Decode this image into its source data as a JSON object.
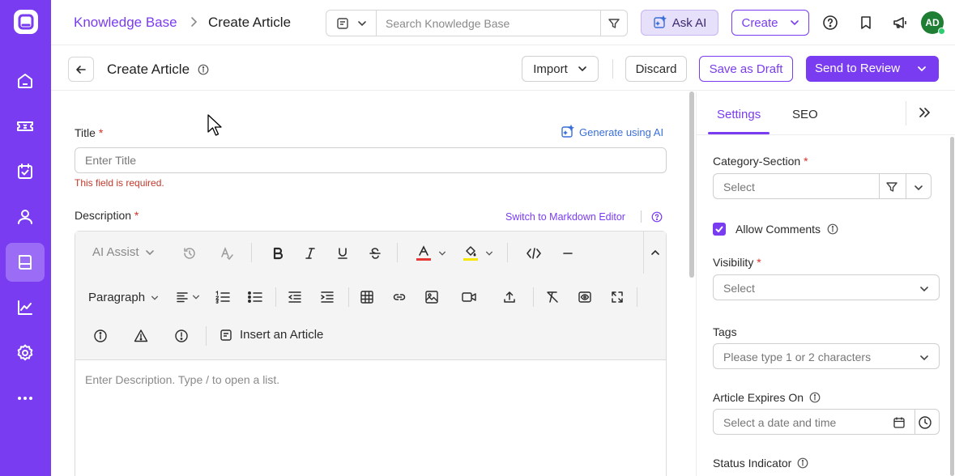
{
  "breadcrumb": {
    "root": "Knowledge Base",
    "current": "Create Article"
  },
  "search": {
    "placeholder": "Search Knowledge Base"
  },
  "header": {
    "ask_ai": "Ask AI",
    "create": "Create",
    "avatar_initials": "AD"
  },
  "subheader": {
    "title": "Create Article",
    "import": "Import",
    "discard": "Discard",
    "save_draft": "Save as Draft",
    "send_review": "Send to Review"
  },
  "form": {
    "title_label": "Title",
    "required_mark": "*",
    "generate_ai": "Generate using AI",
    "title_placeholder": "Enter Title",
    "title_error": "This field is required.",
    "description_label": "Description",
    "markdown_switch": "Switch to Markdown Editor",
    "description_placeholder": "Enter Description. Type / to open a list."
  },
  "toolbar": {
    "ai_assist": "AI Assist",
    "paragraph": "Paragraph",
    "insert_article": "Insert an Article"
  },
  "panel": {
    "tabs": [
      "Settings",
      "SEO"
    ],
    "category_label": "Category-Section",
    "category_placeholder": "Select",
    "allow_comments": "Allow Comments",
    "visibility_label": "Visibility",
    "visibility_placeholder": "Select",
    "tags_label": "Tags",
    "tags_placeholder": "Please type 1 or 2 characters",
    "expires_label": "Article Expires On",
    "expires_placeholder": "Select a date and time",
    "status_label": "Status Indicator"
  },
  "colors": {
    "brand": "#7a3cf0",
    "rail_active": "#9b6cf5",
    "error": "#c0392b",
    "link_blue": "#3a6fd8",
    "avatar": "#1e7e34",
    "text_color_swatch": "#e53935",
    "highlight_swatch": "#f7e600"
  },
  "icons": {
    "rail": [
      "app-logo-icon",
      "home-icon",
      "ticket-icon",
      "tasks-icon",
      "user-icon",
      "knowledge-base-icon",
      "analytics-icon",
      "settings-icon",
      "more-icon"
    ],
    "header": [
      "help-icon",
      "bookmark-icon",
      "announcement-icon"
    ]
  }
}
